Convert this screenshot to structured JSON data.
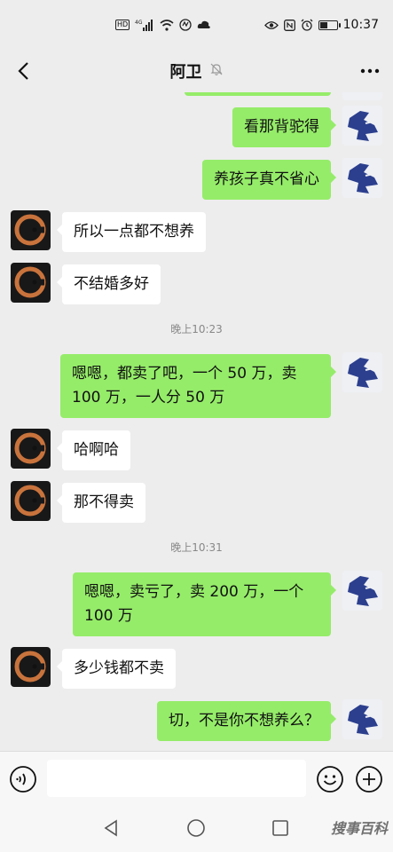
{
  "status_bar": {
    "hd": "HD",
    "network": "4G",
    "time": "10:37"
  },
  "header": {
    "title": "阿卫",
    "icons": [
      "back-arrow-icon",
      "mute-bell-icon",
      "more-icon"
    ]
  },
  "messages": [
    {
      "id": "m1",
      "side": "out",
      "text": "看那背驼得"
    },
    {
      "id": "m2",
      "side": "out",
      "text": "养孩子真不省心"
    },
    {
      "id": "m3",
      "side": "in",
      "text": "所以一点都不想养"
    },
    {
      "id": "m4",
      "side": "in",
      "text": "不结婚多好"
    },
    {
      "id": "t1",
      "type": "timestamp",
      "text": "晚上10:23"
    },
    {
      "id": "m5",
      "side": "out",
      "line1": "嗯嗯，都卖了吧，一个 50 万，卖",
      "line2": "100 万，一人分 50 万"
    },
    {
      "id": "m6",
      "side": "in",
      "text": "哈啊哈"
    },
    {
      "id": "m7",
      "side": "in",
      "text": "那不得卖"
    },
    {
      "id": "t2",
      "type": "timestamp",
      "text": "晚上10:31"
    },
    {
      "id": "m8",
      "side": "out",
      "line1": "嗯嗯，卖亏了，卖 200 万，一个",
      "line2": "100 万"
    },
    {
      "id": "m9",
      "side": "in",
      "text": "多少钱都不卖"
    },
    {
      "id": "m10",
      "side": "out",
      "text": "切，不是你不想养么？"
    }
  ],
  "input_bar": {
    "icons": [
      "voice-icon",
      "emoji-icon",
      "plus-icon"
    ]
  },
  "nav_bar": {
    "icons": [
      "nav-back-icon",
      "nav-home-icon",
      "nav-recent-icon"
    ],
    "watermark": "搜事百科"
  },
  "colors": {
    "background": "#ededed",
    "bubble_out": "#95ec69",
    "bubble_in": "#ffffff",
    "avatar_ring": "#c9733c",
    "avatar_figure": "#2c3f8e"
  }
}
